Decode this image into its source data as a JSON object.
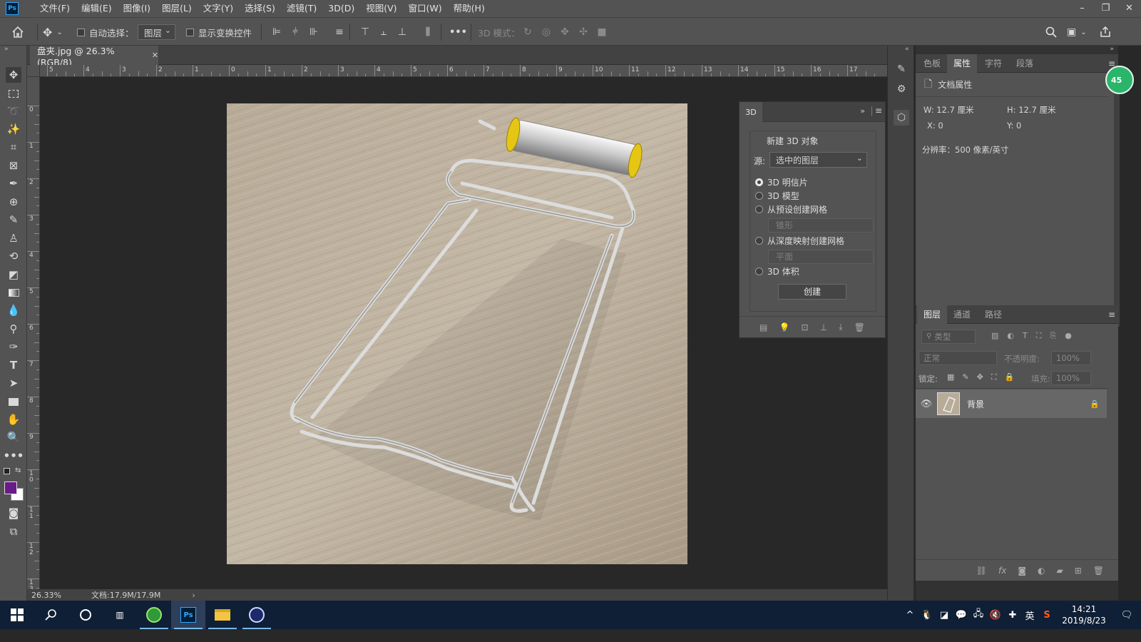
{
  "app": {
    "logo": "Ps",
    "menu": [
      "文件(F)",
      "编辑(E)",
      "图像(I)",
      "图层(L)",
      "文字(Y)",
      "选择(S)",
      "滤镜(T)",
      "3D(D)",
      "视图(V)",
      "窗口(W)",
      "帮助(H)"
    ],
    "window_controls": [
      "minimize-icon",
      "restore-icon",
      "close-icon"
    ]
  },
  "options_bar": {
    "auto_select_label": "自动选择：",
    "auto_select_target": "图层",
    "show_transform_label": "显示变换控件",
    "more_label": "•••",
    "mode_3d_label": "3D 模式："
  },
  "document": {
    "tab_title": "盘夹.jpg @ 26.3%(RGB/8)",
    "zoom": "26.33%",
    "doc_size": "文档:17.9M/17.9M"
  },
  "ruler": {
    "top_labels": [
      "5",
      "4",
      "3",
      "2",
      "1",
      "0",
      "1",
      "2",
      "3",
      "4",
      "5",
      "6",
      "7",
      "8",
      "9",
      "10",
      "11",
      "12",
      "13",
      "14",
      "15",
      "16",
      "17"
    ],
    "left_labels": [
      "0",
      "1",
      "2",
      "3",
      "4",
      "5",
      "6",
      "7",
      "8",
      "9",
      "1\n0",
      "1\n1",
      "1\n2",
      "1\n3"
    ]
  },
  "panel_3d": {
    "tab": "3D",
    "section_title": "新建 3D 对象",
    "source_label": "源:",
    "source_value": "选中的图层",
    "options": [
      "3D 明信片",
      "3D 模型",
      "从预设创建网格",
      "从深度映射创建网格",
      "3D 体积"
    ],
    "selected_option": "3D 明信片",
    "preset_mesh_value": "锥形",
    "depth_map_value": "平面",
    "create_button": "创建"
  },
  "properties_panel": {
    "tabs": [
      "色板",
      "属性",
      "字符",
      "段落"
    ],
    "active_tab": "属性",
    "doc_props_title": "文档属性",
    "w_label": "W:",
    "w_value": "12.7 厘米",
    "h_label": "H:",
    "h_value": "12.7 厘米",
    "x_label": "X:",
    "x_value": "0",
    "y_label": "Y:",
    "y_value": "0",
    "resolution": "分辨率：500 像素/英寸",
    "badge": "45"
  },
  "layers_panel": {
    "tabs": [
      "图层",
      "通道",
      "路径"
    ],
    "active_tab": "图层",
    "filter_placeholder": "类型",
    "blend_mode": "正常",
    "opacity_label": "不透明度:",
    "opacity_value": "100%",
    "lock_label": "锁定:",
    "fill_label": "填充:",
    "fill_value": "100%",
    "layers": [
      {
        "name": "背景",
        "locked": true,
        "visible": true
      }
    ]
  },
  "taskbar": {
    "clock_time": "14:21",
    "clock_date": "2019/8/23",
    "ime_label": "英"
  },
  "colors": {
    "foreground": "#6a1b8a",
    "background": "#ffffff",
    "accent": "#31a8ff",
    "status_badge": "#2bb56a"
  }
}
